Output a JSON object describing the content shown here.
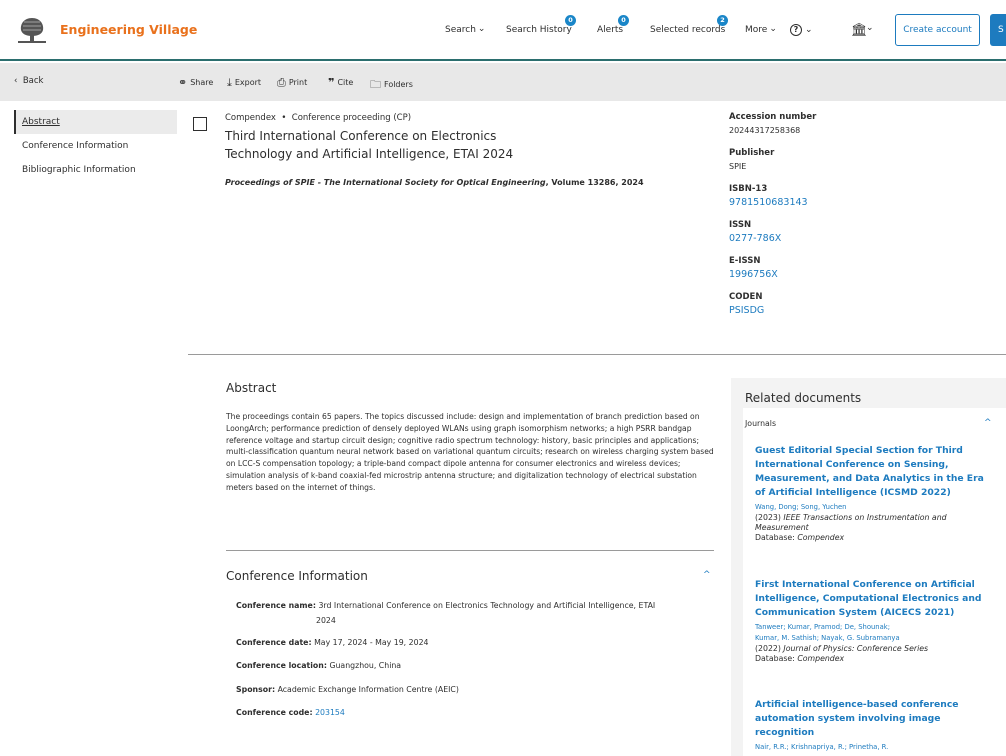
{
  "header": {
    "brand": "Engineering Village",
    "nav": {
      "search": "Search",
      "search_history": "Search History",
      "search_history_badge": "0",
      "alerts": "Alerts",
      "alerts_badge": "0",
      "selected_records": "Selected records",
      "selected_records_badge": "2",
      "more": "More"
    },
    "create_account": "Create account",
    "sign_in_partial": "S"
  },
  "toolbar": {
    "back": "Back",
    "share": "Share",
    "export": "Export",
    "print": "Print",
    "cite": "Cite",
    "folders": "Folders"
  },
  "sidebar": {
    "items": [
      {
        "label": "Abstract"
      },
      {
        "label": "Conference Information"
      },
      {
        "label": "Bibliographic Information"
      }
    ]
  },
  "record": {
    "database": "Compendex",
    "doc_type": "Conference proceeding (CP)",
    "title": "Third International Conference on Electronics Technology and Artificial Intelligence, ETAI 2024",
    "source_journal": "Proceedings of SPIE - The International Society for Optical Engineering",
    "source_volume": ", Volume 13286, 2024"
  },
  "details": {
    "accession_label": "Accession number",
    "accession_value": "20244317258368",
    "publisher_label": "Publisher",
    "publisher_value": "SPIE",
    "isbn_label": "ISBN-13",
    "isbn_value": "9781510683143",
    "issn_label": "ISSN",
    "issn_value": "0277-786X",
    "eissn_label": "E-ISSN",
    "eissn_value": "1996756X",
    "coden_label": "CODEN",
    "coden_value": "PSISDG"
  },
  "abstract": {
    "heading": "Abstract",
    "text": "The proceedings contain 65 papers. The topics discussed include: design and implementation of branch prediction based on LoongArch; performance prediction of densely deployed WLANs using graph isomorphism networks; a high PSRR bandgap reference voltage and startup circuit design; cognitive radio spectrum technology: history, basic principles and applications; multi-classification quantum neural network based on variational quantum circuits; research on wireless charging system based on LCC-S compensation topology; a triple-band compact dipole antenna for consumer electronics and wireless devices; simulation analysis of k-band coaxial-fed microstrip antenna structure; and digitalization technology of electrical substation meters based on the internet of things."
  },
  "conference": {
    "heading": "Conference Information",
    "name_label": "Conference name:",
    "name_value": "3rd International Conference on Electronics Technology and Artificial Intelligence, ETAI",
    "name_value_cont": "2024",
    "date_label": "Conference date:",
    "date_value": "May 17, 2024 - May 19, 2024",
    "location_label": "Conference location:",
    "location_value": "Guangzhou, China",
    "sponsor_label": "Sponsor:",
    "sponsor_value": "Academic Exchange Information Centre (AEIC)",
    "code_label": "Conference code:",
    "code_value": "203154"
  },
  "related": {
    "heading": "Related documents",
    "tab": "Journals",
    "docs": [
      {
        "title": "Guest Editorial Special Section for Third International Conference on Sensing, Measurement, and Data Analytics in the Era of Artificial Intelligence (ICSMD 2022)",
        "authors": "Wang, Dong; Song, Yuchen",
        "year": "(2023) ",
        "journal": "IEEE Transactions on Instrumentation and Measurement",
        "db_label": "Database: ",
        "db": "Compendex"
      },
      {
        "title": "First International Conference on Artificial Intelligence, Computational Electronics and Communication System (AICECS 2021)",
        "authors": "Tanweer;  Kumar, Pramod; De, Shounak;",
        "authors2": "Kumar, M. Sathish; Nayak, G. Subramanya",
        "year": "(2022) ",
        "journal": "Journal of Physics: Conference Series",
        "db_label": "Database: ",
        "db": "Compendex"
      },
      {
        "title": "Artificial intelligence-based conference automation system involving image recognition",
        "authors": "Nair, R.R.; Krishnapriya, R.; Prinetha, R."
      }
    ]
  }
}
